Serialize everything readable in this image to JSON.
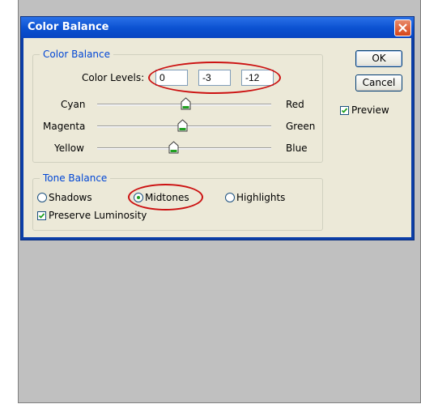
{
  "dialog": {
    "title": "Color Balance",
    "close_icon": "close-icon"
  },
  "color_balance": {
    "group_label": "Color Balance",
    "levels_label": "Color Levels:",
    "levels": [
      "0",
      "-3",
      "-12"
    ],
    "sliders": [
      {
        "left": "Cyan",
        "right": "Red",
        "value": 0
      },
      {
        "left": "Magenta",
        "right": "Green",
        "value": -3
      },
      {
        "left": "Yellow",
        "right": "Blue",
        "value": -12
      }
    ]
  },
  "tone_balance": {
    "group_label": "Tone Balance",
    "options": [
      "Shadows",
      "Midtones",
      "Highlights"
    ],
    "selected": "Midtones",
    "preserve_label": "Preserve Luminosity",
    "preserve_checked": true
  },
  "buttons": {
    "ok": "OK",
    "cancel": "Cancel"
  },
  "preview": {
    "label": "Preview",
    "checked": true
  },
  "colors": {
    "annotation_ring": "#cc1111",
    "title_bar": "#0a50d0",
    "dialog_bg": "#ece9d8"
  }
}
